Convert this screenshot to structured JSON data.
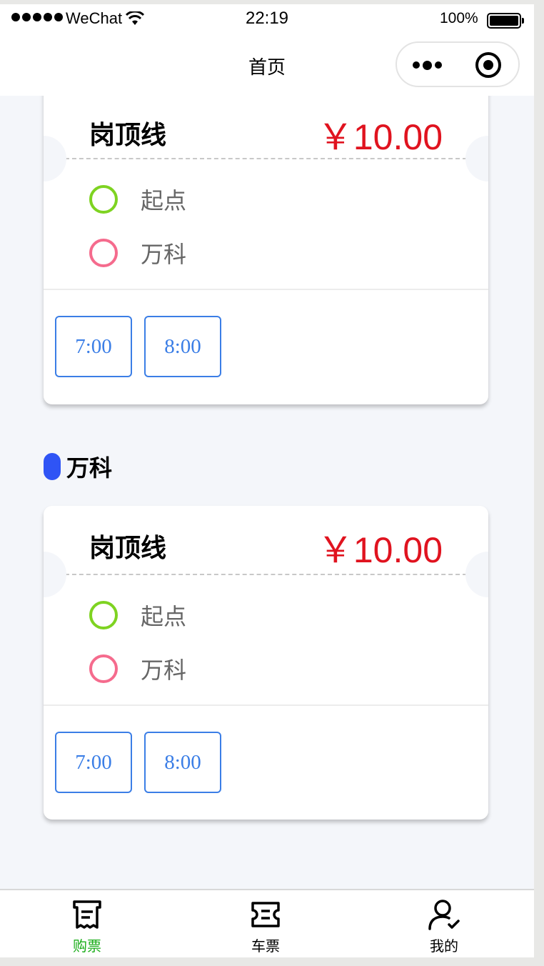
{
  "status_bar": {
    "carrier": "WeChat",
    "time": "22:19",
    "battery": "100%"
  },
  "nav": {
    "title": "首页"
  },
  "cards": [
    {
      "route": "岗顶线",
      "price": "￥10.00",
      "stops": [
        {
          "name": "起点",
          "color": "#7ed321"
        },
        {
          "name": "万科",
          "color": "#f56b8d"
        }
      ],
      "times": [
        "7:00",
        "8:00"
      ]
    },
    {
      "route": "岗顶线",
      "price": "￥10.00",
      "stops": [
        {
          "name": "起点",
          "color": "#7ed321"
        },
        {
          "name": "万科",
          "color": "#f56b8d"
        }
      ],
      "times": [
        "7:00",
        "8:00"
      ]
    }
  ],
  "section": {
    "title": "万科"
  },
  "tabs": [
    {
      "label": "购票",
      "icon": "ticket-receipt-icon",
      "active": true
    },
    {
      "label": "车票",
      "icon": "ticket-icon",
      "active": false
    },
    {
      "label": "我的",
      "icon": "user-check-icon",
      "active": false
    }
  ],
  "colors": {
    "accent": "#1aad19",
    "price": "#e0131f",
    "time_button": "#3b7ee6",
    "section_bar": "#2f54f5"
  }
}
